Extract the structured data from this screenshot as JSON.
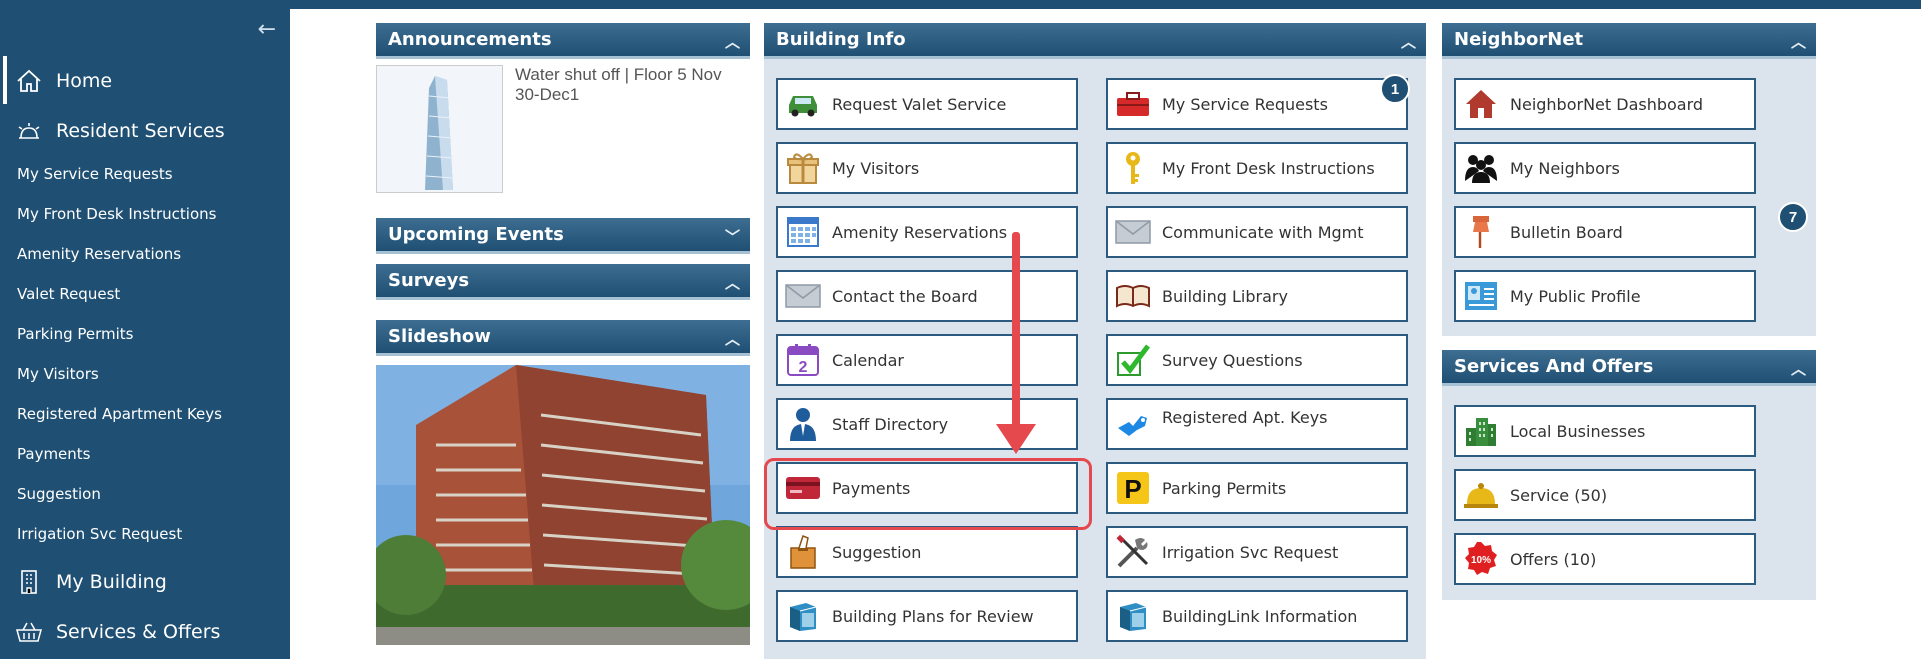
{
  "sidebar": {
    "collapse_icon": "arrow-left-icon",
    "main_items": [
      {
        "label": "Home",
        "icon": "home-icon"
      },
      {
        "label": "Resident Services",
        "icon": "bell-icon"
      },
      {
        "label": "My Building",
        "icon": "building-icon"
      },
      {
        "label": "Services & Offers",
        "icon": "basket-icon"
      }
    ],
    "sub_items": [
      "My Service Requests",
      "My Front Desk Instructions",
      "Amenity Reservations",
      "Valet Request",
      "Parking Permits",
      "My Visitors",
      "Registered Apartment Keys",
      "Payments",
      "Suggestion",
      "Irrigation Svc Request"
    ]
  },
  "announcements": {
    "title": "Announcements",
    "item_text": "Water shut off | Floor 5 Nov 30-Dec1"
  },
  "upcoming_events": {
    "title": "Upcoming Events"
  },
  "surveys": {
    "title": "Surveys"
  },
  "slideshow": {
    "title": "Slideshow"
  },
  "building_info": {
    "title": "Building Info",
    "tiles": [
      {
        "label": "Request Valet Service",
        "icon": "car-icon"
      },
      {
        "label": "My Service Requests",
        "icon": "toolbox-icon",
        "badge": "1"
      },
      {
        "label": "My Visitors",
        "icon": "gift-icon"
      },
      {
        "label": "My Front Desk Instructions",
        "icon": "key-icon"
      },
      {
        "label": "Amenity Reservations",
        "icon": "calendar-grid-icon"
      },
      {
        "label": "Communicate with Mgmt",
        "icon": "envelope-icon"
      },
      {
        "label": "Contact the Board",
        "icon": "envelope-icon"
      },
      {
        "label": "Building Library",
        "icon": "book-icon"
      },
      {
        "label": "Calendar",
        "icon": "calendar-icon",
        "day": "2"
      },
      {
        "label": "Survey Questions",
        "icon": "checkmark-icon"
      },
      {
        "label": "Staff Directory",
        "icon": "person-icon"
      },
      {
        "label": "Registered Apt. Keys",
        "icon": "blue-key-icon"
      },
      {
        "label": "Payments",
        "icon": "credit-card-icon"
      },
      {
        "label": "Parking Permits",
        "icon": "parking-icon",
        "letter": "P"
      },
      {
        "label": "Suggestion",
        "icon": "suggestion-box-icon"
      },
      {
        "label": "Irrigation Svc Request",
        "icon": "tools-icon"
      },
      {
        "label": "Building Plans for Review",
        "icon": "binder-icon"
      },
      {
        "label": "BuildingLink Information",
        "icon": "binder-icon"
      }
    ]
  },
  "neighbornet": {
    "title": "NeighborNet",
    "tiles": [
      {
        "label": "NeighborNet Dashboard",
        "icon": "house-icon"
      },
      {
        "label": "My Neighbors",
        "icon": "people-icon"
      },
      {
        "label": "Bulletin Board",
        "icon": "pushpin-icon",
        "badge": "7"
      },
      {
        "label": "My Public Profile",
        "icon": "profile-card-icon"
      }
    ]
  },
  "services_offers": {
    "title": "Services And Offers",
    "tiles": [
      {
        "label": "Local Businesses",
        "icon": "office-building-icon"
      },
      {
        "label": "Service (50)",
        "icon": "service-bell-icon"
      },
      {
        "label": "Offers (10)",
        "icon": "discount-badge-icon",
        "badge_text": "10%"
      }
    ]
  },
  "colors": {
    "primary": "#1f4f72",
    "panel_bg": "#dbe4ec",
    "annotation": "#e5484d"
  }
}
